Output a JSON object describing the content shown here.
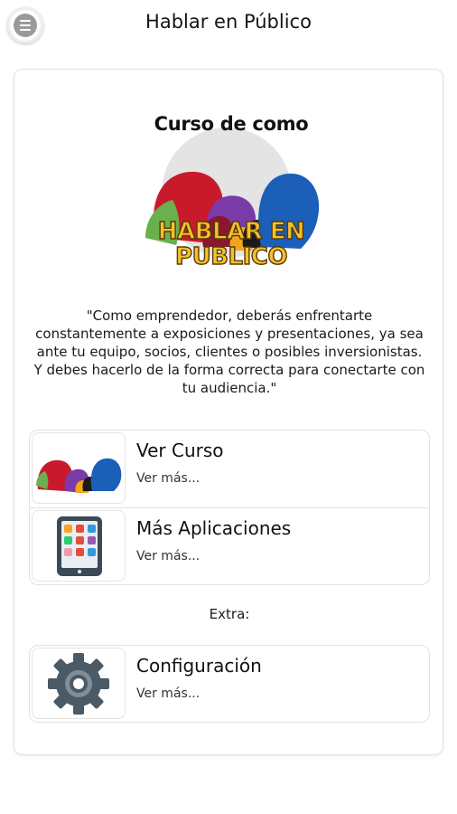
{
  "app": {
    "title": "Hablar en Público"
  },
  "icons": {
    "menu": "hamburger-menu-icon",
    "course": "people-silhouettes-icon",
    "apps": "tablet-apps-icon",
    "settings": "gear-icon"
  },
  "logo": {
    "heading": "Curso de como",
    "line1": "HABLAR EN",
    "line2": "PUBLICO"
  },
  "quote": "\"Como emprendedor, deberás enfrentarte constantemente a exposiciones y presentaciones, ya sea ante tu equipo, socios, clientes o posibles inversionistas. Y debes hacerlo de la forma correcta para conectarte con tu audiencia.\"",
  "menu_items": [
    {
      "title": "Ver Curso",
      "subtitle": "Ver más..."
    },
    {
      "title": "Más Aplicaciones",
      "subtitle": "Ver más..."
    }
  ],
  "extra_label": "Extra:",
  "extra_items": [
    {
      "title": "Configuración",
      "subtitle": "Ver más..."
    }
  ],
  "colors": {
    "card_border": "#e2e2e2",
    "logo_text_fill": "#f2c12e",
    "logo_text_stroke": "#5a3a06",
    "people_red": "#c91a2b",
    "people_purple": "#7a3aa8",
    "people_blue": "#1c5fb8",
    "people_green": "#6ab04c",
    "gear": "#4a5a66"
  }
}
